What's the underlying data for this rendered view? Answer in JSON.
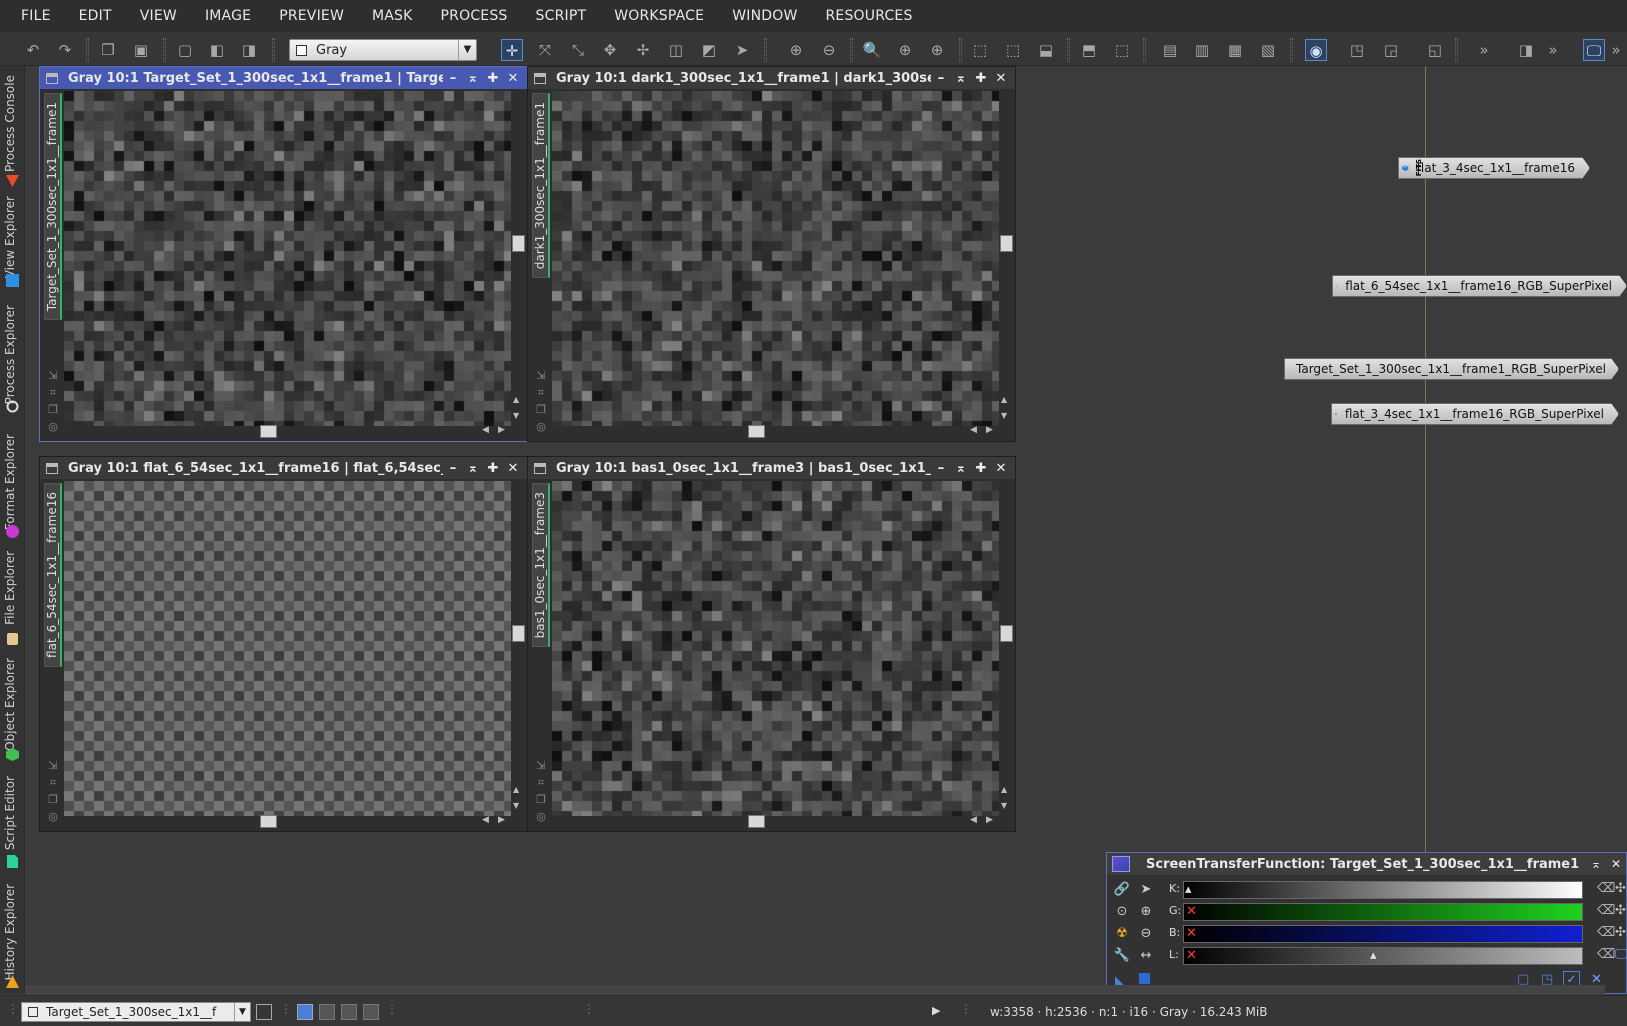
{
  "menu": [
    "FILE",
    "EDIT",
    "VIEW",
    "IMAGE",
    "PREVIEW",
    "MASK",
    "PROCESS",
    "SCRIPT",
    "WORKSPACE",
    "WINDOW",
    "RESOURCES"
  ],
  "toolbar": {
    "view_mode": "Gray",
    "overflow": "»"
  },
  "dock_tabs": [
    "Process Console",
    "View Explorer",
    "Process Explorer",
    "Format Explorer",
    "File Explorer",
    "Object Explorer",
    "Script Editor",
    "History Explorer"
  ],
  "windows": [
    {
      "title": "Gray 10:1 Target_Set_1_300sec_1x1__frame1 | Target...",
      "tab": "Target_Set_1_300sec_1x1__frame1"
    },
    {
      "title": "Gray 10:1 dark1_300sec_1x1__frame1 | dark1_300sec...",
      "tab": "dark1_300sec_1x1__frame1"
    },
    {
      "title": "Gray 10:1 flat_6_54sec_1x1__frame16 | flat_6,54sec_1...",
      "tab": "flat_6_54sec_1x1__frame16"
    },
    {
      "title": "Gray 10:1 bas1_0sec_1x1__frame3 | bas1_0sec_1x1__f...",
      "tab": "bas1_0sec_1x1__frame3"
    }
  ],
  "icons": [
    {
      "label": "flat_3_4sec_1x1__frame16",
      "badge": "FITS"
    },
    {
      "label": "flat_6_54sec_1x1__frame16_RGB_SuperPixel"
    },
    {
      "label": "Target_Set_1_300sec_1x1__frame1_RGB_SuperPixel"
    },
    {
      "label": "flat_3_4sec_1x1__frame16_RGB_SuperPixel"
    }
  ],
  "stf": {
    "title": "ScreenTransferFunction: Target_Set_1_300sec_1x1__frame1",
    "channels": [
      "K:",
      "G:",
      "B:",
      "L:"
    ],
    "colors": {
      "K": "#ffffff",
      "G": "#1fd21f",
      "B": "#1020d0",
      "L": "#bdbdbd"
    }
  },
  "status": {
    "view": "Target_Set_1_300sec_1x1__f",
    "info": "w:3358 · h:2536 · n:1 · i16 · Gray · 16.243 MiB"
  },
  "colors": {
    "accent": "#4759b0",
    "background": "#3b3b3b"
  }
}
